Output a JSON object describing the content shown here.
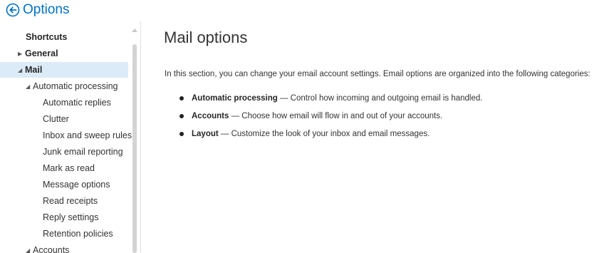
{
  "header": {
    "title": "Options"
  },
  "sidebar": {
    "items": [
      {
        "label": "Shortcuts"
      },
      {
        "label": "General"
      },
      {
        "label": "Mail"
      },
      {
        "label": "Automatic processing"
      },
      {
        "label": "Automatic replies"
      },
      {
        "label": "Clutter"
      },
      {
        "label": "Inbox and sweep rules"
      },
      {
        "label": "Junk email reporting"
      },
      {
        "label": "Mark as read"
      },
      {
        "label": "Message options"
      },
      {
        "label": "Read receipts"
      },
      {
        "label": "Reply settings"
      },
      {
        "label": "Retention policies"
      },
      {
        "label": "Accounts"
      }
    ]
  },
  "main": {
    "title": "Mail options",
    "intro": "In this section, you can change your email account settings. Email options are organized into the following categories:",
    "categories": [
      {
        "name": "Automatic processing",
        "desc": " — Control how incoming and outgoing email is handled."
      },
      {
        "name": "Accounts",
        "desc": " — Choose how email will flow in and out of your accounts."
      },
      {
        "name": "Layout",
        "desc": " — Customize the look of your inbox and email messages."
      }
    ]
  },
  "colors": {
    "accent": "#0072c6",
    "selected_bg": "#dcebf8"
  }
}
